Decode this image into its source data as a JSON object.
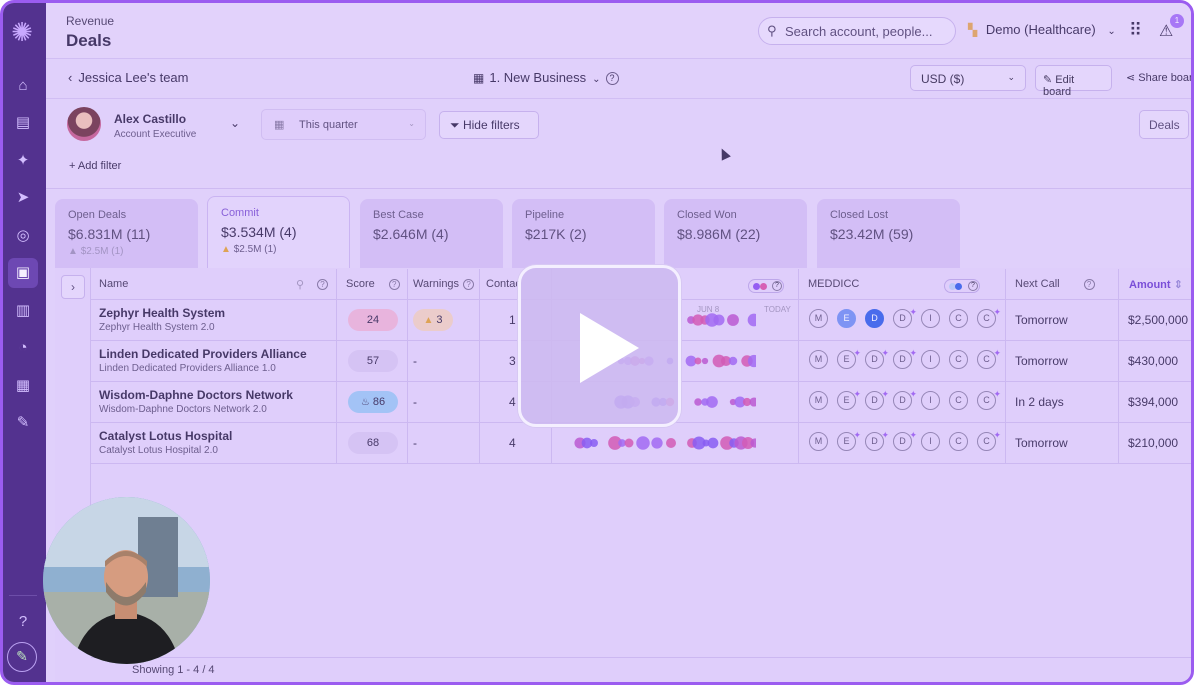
{
  "header": {
    "section": "Revenue",
    "title": "Deals",
    "search_placeholder": "Search account, people...",
    "org_name": "Demo (Healthcare)",
    "alert_count": "1"
  },
  "subheader": {
    "back_label": "Jessica Lee's team",
    "board_name": "1. New Business",
    "currency": "USD ($)",
    "edit_label": "Edit board",
    "share_label": "Share board"
  },
  "filters": {
    "owner_name": "Alex Castillo",
    "owner_role": "Account Executive",
    "period": "This quarter",
    "hide_filters": "Hide filters",
    "view_button": "Deals",
    "add_filter": "+ Add filter"
  },
  "tabs": [
    {
      "label": "Open Deals",
      "value": "$6.831M (11)",
      "sub": "$2.5M (1)",
      "sub_icon": "warning-icon-gray"
    },
    {
      "label": "Commit",
      "value": "$3.534M (4)",
      "sub": "$2.5M (1)",
      "sub_icon": "warning-icon-orange"
    },
    {
      "label": "Best Case",
      "value": "$2.646M (4)",
      "sub": ""
    },
    {
      "label": "Pipeline",
      "value": "$217K (2)",
      "sub": ""
    },
    {
      "label": "Closed Won",
      "value": "$8.986M (22)",
      "sub": ""
    },
    {
      "label": "Closed Lost",
      "value": "$23.42M (59)",
      "sub": ""
    }
  ],
  "columns": {
    "name": "Name",
    "score": "Score",
    "warnings": "Warnings",
    "contacts": "Contac",
    "meddicc": "MEDDICC",
    "next_call": "Next Call",
    "amount": "Amount",
    "timeline_mid": "JUN 8",
    "timeline_end": "TODAY"
  },
  "rows": [
    {
      "name": "Zephyr Health System",
      "sub": "Zephyr Health System 2.0",
      "score": "24",
      "score_color": "#f0b6d6",
      "warnings": "3",
      "contacts": "1",
      "next_call": "Tomorrow",
      "amount": "$2,500,000"
    },
    {
      "name": "Linden Dedicated Providers Alliance",
      "sub": "Linden Dedicated Providers Alliance 1.0",
      "score": "57",
      "score_color": "#d8c8f2",
      "warnings": "-",
      "contacts": "3",
      "next_call": "Tomorrow",
      "amount": "$430,000"
    },
    {
      "name": "Wisdom-Daphne Doctors Network",
      "sub": "Wisdom-Daphne Doctors Network 2.0",
      "score": "86",
      "score_color": "#9cc8f4",
      "score_icon": "flame-icon",
      "warnings": "-",
      "contacts": "4",
      "next_call": "In 2 days",
      "amount": "$394,000"
    },
    {
      "name": "Catalyst Lotus Hospital",
      "sub": "Catalyst Lotus Hospital 2.0",
      "score": "68",
      "score_color": "#d8c8f2",
      "warnings": "-",
      "contacts": "4",
      "next_call": "Tomorrow",
      "amount": "$210,000"
    }
  ],
  "meddicc_letters": [
    "M",
    "E",
    "D",
    "D",
    "I",
    "C",
    "C"
  ],
  "footer": {
    "showing": "Showing 1 - 4 / 4"
  },
  "colors": {
    "accent": "#9b5cf0",
    "sidebar": "#3a1877"
  }
}
